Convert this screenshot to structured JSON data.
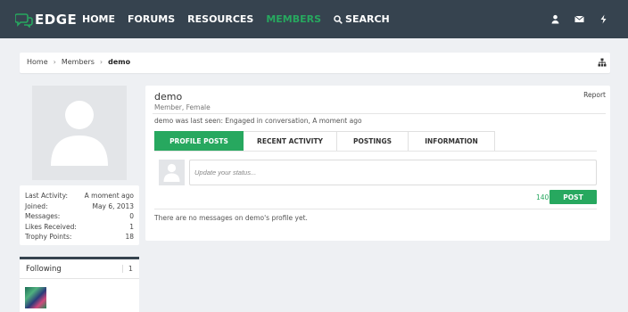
{
  "brand": {
    "name": "EDGE",
    "accent": "#27a85f",
    "nav_bg": "#36434f"
  },
  "nav": {
    "items": [
      {
        "label": "HOME"
      },
      {
        "label": "FORUMS"
      },
      {
        "label": "RESOURCES"
      },
      {
        "label": "MEMBERS"
      },
      {
        "label": "SEARCH"
      }
    ],
    "active": "MEMBERS",
    "icons": [
      "user-icon",
      "envelope-icon",
      "bolt-icon"
    ]
  },
  "breadcrumb": {
    "items": [
      "Home",
      "Members"
    ],
    "current": "demo"
  },
  "stats": [
    {
      "label": "Last Activity:",
      "value": "A moment ago"
    },
    {
      "label": "Joined:",
      "value": "May 6, 2013"
    },
    {
      "label": "Messages:",
      "value": "0"
    },
    {
      "label": "Likes Received:",
      "value": "1"
    },
    {
      "label": "Trophy Points:",
      "value": "18"
    }
  ],
  "following": {
    "title": "Following",
    "count": "1"
  },
  "profile": {
    "username": "demo",
    "user_title": "Member, Female",
    "report": "Report",
    "last_seen": "demo was last seen: Engaged in conversation, A moment ago"
  },
  "tabs": [
    "PROFILE POSTS",
    "RECENT ACTIVITY",
    "POSTINGS",
    "INFORMATION"
  ],
  "active_tab": "PROFILE POSTS",
  "status": {
    "placeholder": "Update your status...",
    "char_count": "140",
    "post_label": "POST"
  },
  "empty_message": "There are no messages on demo's profile yet."
}
